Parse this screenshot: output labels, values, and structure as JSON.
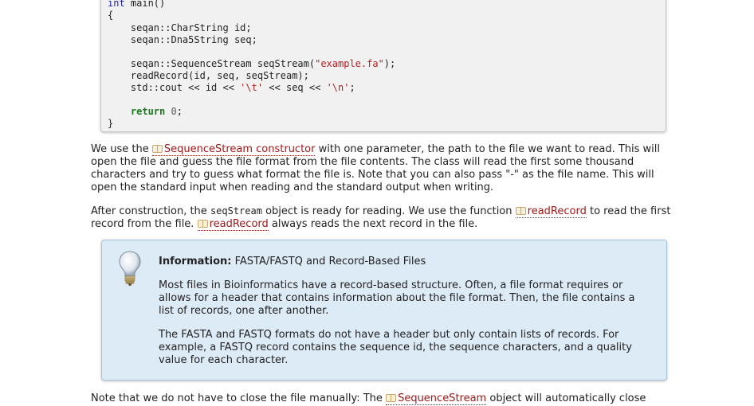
{
  "code": {
    "lines": [
      {
        "type": "int",
        "rest": " main()"
      },
      {
        "text": "{"
      },
      {
        "text": "    seqan::CharString id;"
      },
      {
        "text": "    seqan::Dna5String seq;"
      },
      {
        "text": ""
      },
      {
        "pre": "    seqan::SequenceStream seqStream(",
        "str": "\"example.fa\"",
        "post": ");"
      },
      {
        "text": "    readRecord(id, seq, seqStream);"
      },
      {
        "pre": "    std::cout << id << ",
        "str1": "'\\t'",
        "mid": " << seq << ",
        "str2": "'\\n'",
        "post": ";"
      },
      {
        "text": ""
      },
      {
        "ret": "return",
        "num": " 0",
        "post": ";"
      },
      {
        "text": "}"
      }
    ]
  },
  "para1": {
    "prefix": "We use the ",
    "link": "SequenceStream constructor",
    "suffix": " with one parameter, the path to the file we want to read. This will open the file and guess the file format from the file contents. The class will read the first some thousand characters and try to guess what format the file is. Note that you can also pass \"-\" as the file name. This will open the standard input when reading and the standard output when writing."
  },
  "para2": {
    "prefix": "After construction, the ",
    "code": "seqStream",
    "mid": " object is ready for reading. We use the function ",
    "link1": "readRecord",
    "mid2": " to read the first record from the file. ",
    "link2": "readRecord",
    "suffix": " always reads the next record in the file."
  },
  "info": {
    "title_bold": "Information:",
    "title_rest": " FASTA/FASTQ and Record-Based Files",
    "p1": "Most files in Bioinformatics have a record-based structure. Often, a file format requires or allows for a header that contains information about the file format. Then, the file contains a list of records, one after another.",
    "p2": "The FASTA and FASTQ formats do not have a header but only contain lists of records. For example, a FASTQ record contains the sequence id, the sequence characters, and a quality value for each character."
  },
  "para3": {
    "prefix": "Note that we do not have to close the file manually: The ",
    "link": "SequenceStream",
    "suffix": " object will automatically close"
  }
}
